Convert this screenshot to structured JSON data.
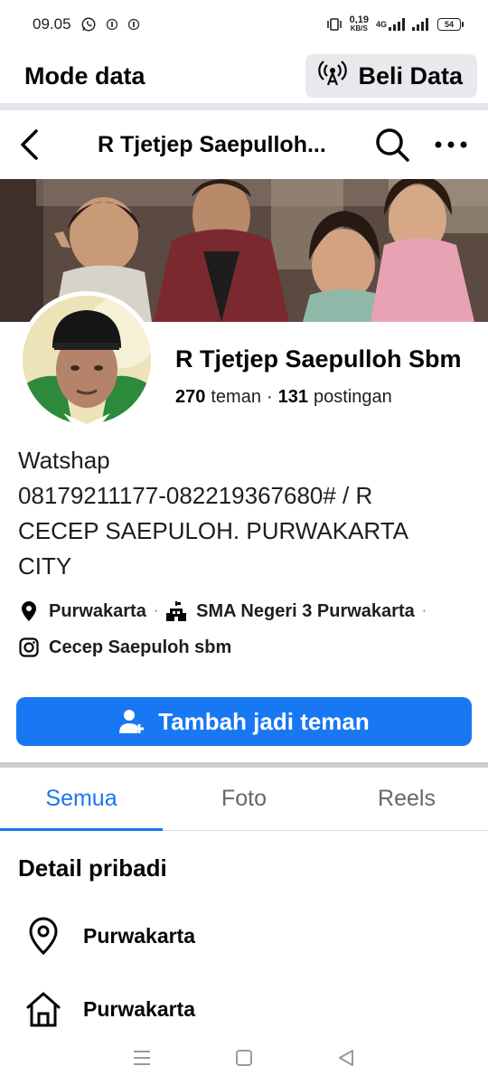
{
  "status_bar": {
    "time": "09.05",
    "net_speed": "0,19",
    "net_unit": "KB/S",
    "network_type": "4G",
    "battery": "54"
  },
  "mode_bar": {
    "title": "Mode data",
    "button_label": "Beli Data"
  },
  "header": {
    "title": "R Tjetjep Saepulloh..."
  },
  "profile": {
    "name": "R Tjetjep Saepulloh Sbm",
    "friends_count": "270",
    "friends_label": "teman",
    "separator": "·",
    "posts_count": "131",
    "posts_label": "postingan",
    "bio_lines": [
      "Watshap",
      "08179211177-082219367680# / R",
      "CECEP SAEPULOH. PURWAKARTA",
      "CITY"
    ],
    "location": "Purwakarta",
    "school": "SMA Negeri 3 Purwakarta",
    "instagram": "Cecep Saepuloh sbm",
    "dot": "·"
  },
  "actions": {
    "add_friend": "Tambah jadi teman"
  },
  "tabs": [
    {
      "label": "Semua",
      "active": true
    },
    {
      "label": "Foto",
      "active": false
    },
    {
      "label": "Reels",
      "active": false
    }
  ],
  "details": {
    "title": "Detail pribadi",
    "items": [
      {
        "icon": "location-pin-icon",
        "text": "Purwakarta"
      },
      {
        "icon": "home-icon",
        "text": "Purwakarta"
      }
    ]
  },
  "colors": {
    "accent": "#1877f2",
    "text": "#050505",
    "muted": "#65676b"
  }
}
